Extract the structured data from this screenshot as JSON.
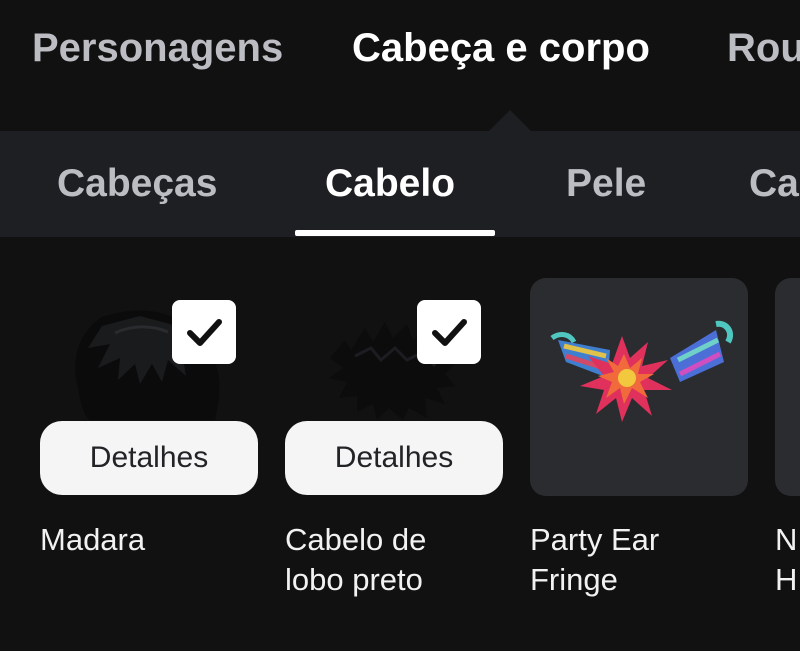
{
  "top_tabs": [
    {
      "label": "Personagens",
      "active": false
    },
    {
      "label": "Cabeça e corpo",
      "active": true
    },
    {
      "label": "Rou",
      "active": false
    }
  ],
  "sub_tabs": [
    {
      "label": "Cabeças",
      "active": false
    },
    {
      "label": "Cabelo",
      "active": true
    },
    {
      "label": "Pele",
      "active": false
    },
    {
      "label": "Ca",
      "active": false
    }
  ],
  "items": [
    {
      "name": "Madara",
      "selected": true,
      "button": "Detalhes"
    },
    {
      "name": "Cabelo de\nlobo preto",
      "selected": true,
      "button": "Detalhes"
    },
    {
      "name": "Party Ear\nFringe",
      "selected": false
    },
    {
      "name": "N\nH",
      "selected": false
    }
  ],
  "colors": {
    "background": "#111112",
    "subbar": "#1e1f22",
    "card": "#2b2c30",
    "text_primary": "#ffffff",
    "text_secondary": "#bcbdc2"
  },
  "icons": {
    "check": "checkmark-icon"
  }
}
